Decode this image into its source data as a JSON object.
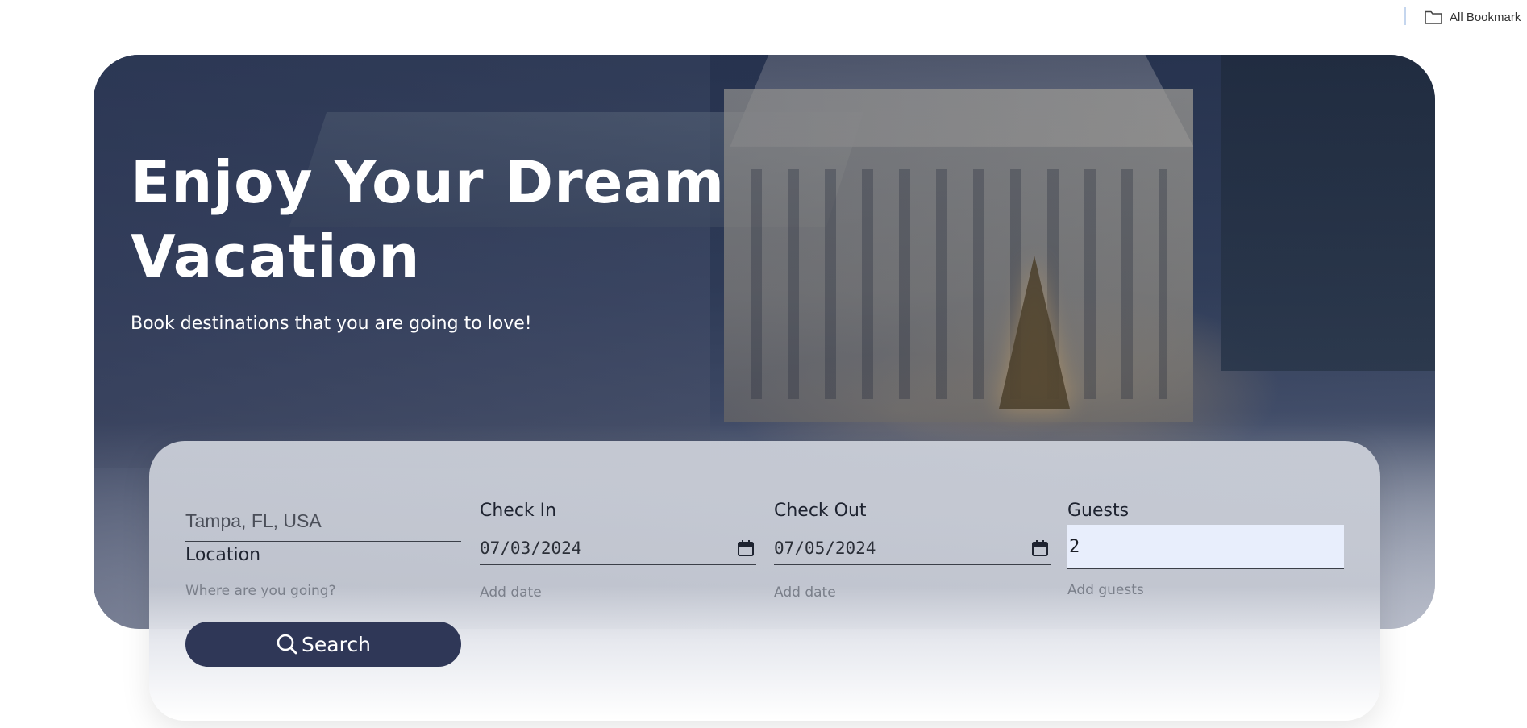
{
  "bookmarks": {
    "all_bookmarks_label": "All Bookmark",
    "folder_icon": "folder-icon"
  },
  "hero": {
    "title": "Enjoy Your Dream Vacation",
    "subtitle": "Book destinations that you are going to love!"
  },
  "search": {
    "location": {
      "placeholder": "Tampa, FL, USA",
      "label": "Location",
      "hint": "Where are you going?"
    },
    "check_in": {
      "label": "Check In",
      "value": "07/03/2024",
      "hint": "Add date",
      "icon": "calendar-icon"
    },
    "check_out": {
      "label": "Check Out",
      "value": "07/05/2024",
      "hint": "Add date",
      "icon": "calendar-icon"
    },
    "guests": {
      "label": "Guests",
      "value": "2",
      "hint": "Add guests"
    },
    "button_label": "Search",
    "button_icon": "search-icon"
  },
  "colors": {
    "button": "#2f3757",
    "guests_field_bg": "#e8eefc",
    "divider": "#c5d6ee"
  }
}
